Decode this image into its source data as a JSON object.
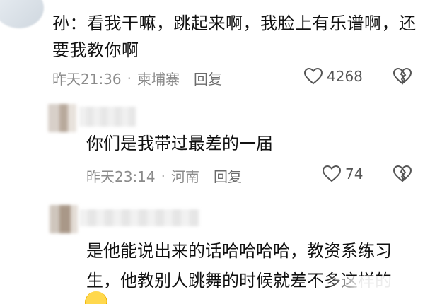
{
  "comments": [
    {
      "text": "孙：看我干嘛，跳起来啊，我脸上有乐谱啊，还要我教你啊",
      "time": "昨天21:36",
      "location": "柬埔寨",
      "reply_label": "回复",
      "likes": "4268"
    },
    {
      "text": "你们是我带过最差的一届",
      "time": "昨天23:14",
      "location": "河南",
      "reply_label": "回复",
      "likes": "74"
    },
    {
      "text": "是他能说出来的话哈哈哈哈，教资系练习生，他教别人跳舞的时候就差不多这样的"
    }
  ],
  "icons": {
    "like": "heart-outline-icon",
    "dislike": "broken-heart-icon",
    "emoji": "laughing-emoji-icon"
  },
  "colors": {
    "text": "#111111",
    "meta": "#8a8a8a",
    "icon": "#555555"
  }
}
